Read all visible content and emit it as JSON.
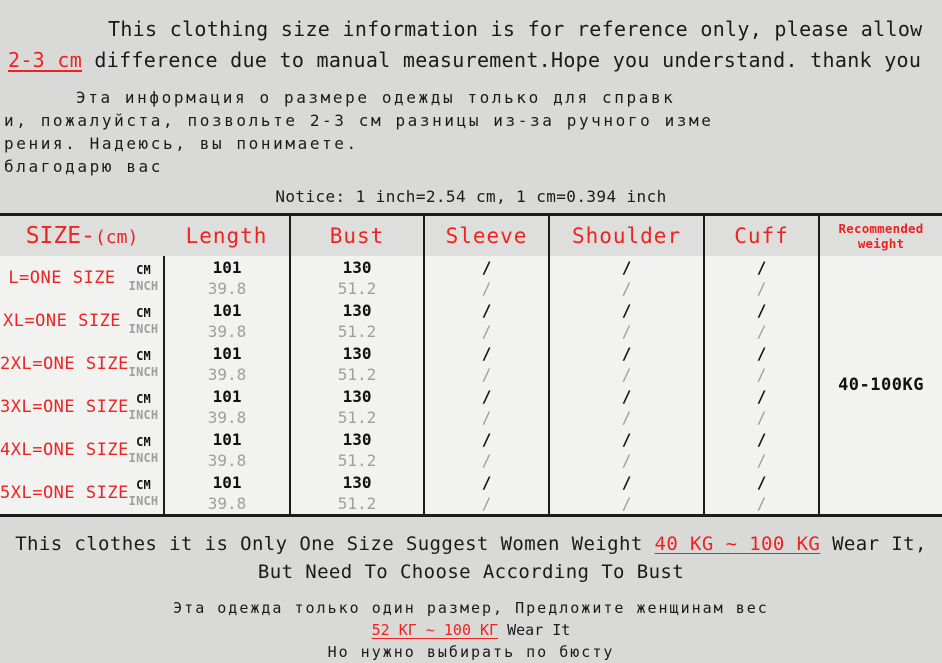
{
  "intro": {
    "english": {
      "part1": "This clothing size information is for reference only, please allow ",
      "highlight": "2-3 cm",
      "part2": " difference due to manual measurement.Hope you understand. thank you"
    },
    "russian_lines": [
      "Эта информация о размере одежды только для справк",
      "и, пожалуйста, позвольте 2-3 см разницы из-за ручного изме",
      "рения. Надеюсь, вы понимаете.",
      "благодарю вас"
    ]
  },
  "notice": "Notice: 1 inch=2.54 cm,  1 cm=0.394 inch",
  "table": {
    "headers": {
      "size": "SIZE-",
      "size_unit": "(cm)",
      "length": "Length",
      "bust": "Bust",
      "sleeve": "Sleeve",
      "shoulder": "Shoulder",
      "cuff": "Cuff",
      "recommended": "Recommended",
      "recommended2": "weight"
    },
    "unit_labels": {
      "cm": "CM",
      "inch": "INCH"
    },
    "recommended_weight": "40-100KG",
    "rows": [
      {
        "size": "L=ONE SIZE",
        "length_cm": "101",
        "length_in": "39.8",
        "bust_cm": "130",
        "bust_in": "51.2",
        "sleeve_cm": "/",
        "sleeve_in": "/",
        "shoulder_cm": "/",
        "shoulder_in": "/",
        "cuff_cm": "/",
        "cuff_in": "/"
      },
      {
        "size": "XL=ONE SIZE",
        "length_cm": "101",
        "length_in": "39.8",
        "bust_cm": "130",
        "bust_in": "51.2",
        "sleeve_cm": "/",
        "sleeve_in": "/",
        "shoulder_cm": "/",
        "shoulder_in": "/",
        "cuff_cm": "/",
        "cuff_in": "/"
      },
      {
        "size": "2XL=ONE SIZE",
        "length_cm": "101",
        "length_in": "39.8",
        "bust_cm": "130",
        "bust_in": "51.2",
        "sleeve_cm": "/",
        "sleeve_in": "/",
        "shoulder_cm": "/",
        "shoulder_in": "/",
        "cuff_cm": "/",
        "cuff_in": "/"
      },
      {
        "size": "3XL=ONE SIZE",
        "length_cm": "101",
        "length_in": "39.8",
        "bust_cm": "130",
        "bust_in": "51.2",
        "sleeve_cm": "/",
        "sleeve_in": "/",
        "shoulder_cm": "/",
        "shoulder_in": "/",
        "cuff_cm": "/",
        "cuff_in": "/"
      },
      {
        "size": "4XL=ONE SIZE",
        "length_cm": "101",
        "length_in": "39.8",
        "bust_cm": "130",
        "bust_in": "51.2",
        "sleeve_cm": "/",
        "sleeve_in": "/",
        "shoulder_cm": "/",
        "shoulder_in": "/",
        "cuff_cm": "/",
        "cuff_in": "/"
      },
      {
        "size": "5XL=ONE SIZE",
        "length_cm": "101",
        "length_in": "39.8",
        "bust_cm": "130",
        "bust_in": "51.2",
        "sleeve_cm": "/",
        "sleeve_in": "/",
        "shoulder_cm": "/",
        "shoulder_in": "/",
        "cuff_cm": "/",
        "cuff_in": "/"
      }
    ]
  },
  "footer": {
    "english_line1_part1": "This clothes it is Only One Size Suggest Women Weight ",
    "english_line1_highlight": "40 KG ~ 100 KG",
    "english_line1_part2": " Wear It,",
    "english_line2": "But Need To Choose According To Bust",
    "russian_line1": "Эта одежда только один размер, Предложите женщинам вес",
    "russian_line2_highlight": "52 КГ ~ 100 КГ",
    "russian_line2_suffix": "Wear It",
    "russian_line3": "Но нужно выбирать по бюсту"
  },
  "colors": {
    "accent_red": "#ef2222",
    "page_bg": "#d9dad7",
    "table_bg": "#f2f2f0",
    "header_bg": "#dedfdc",
    "inch_gray": "#9e9e9e"
  }
}
